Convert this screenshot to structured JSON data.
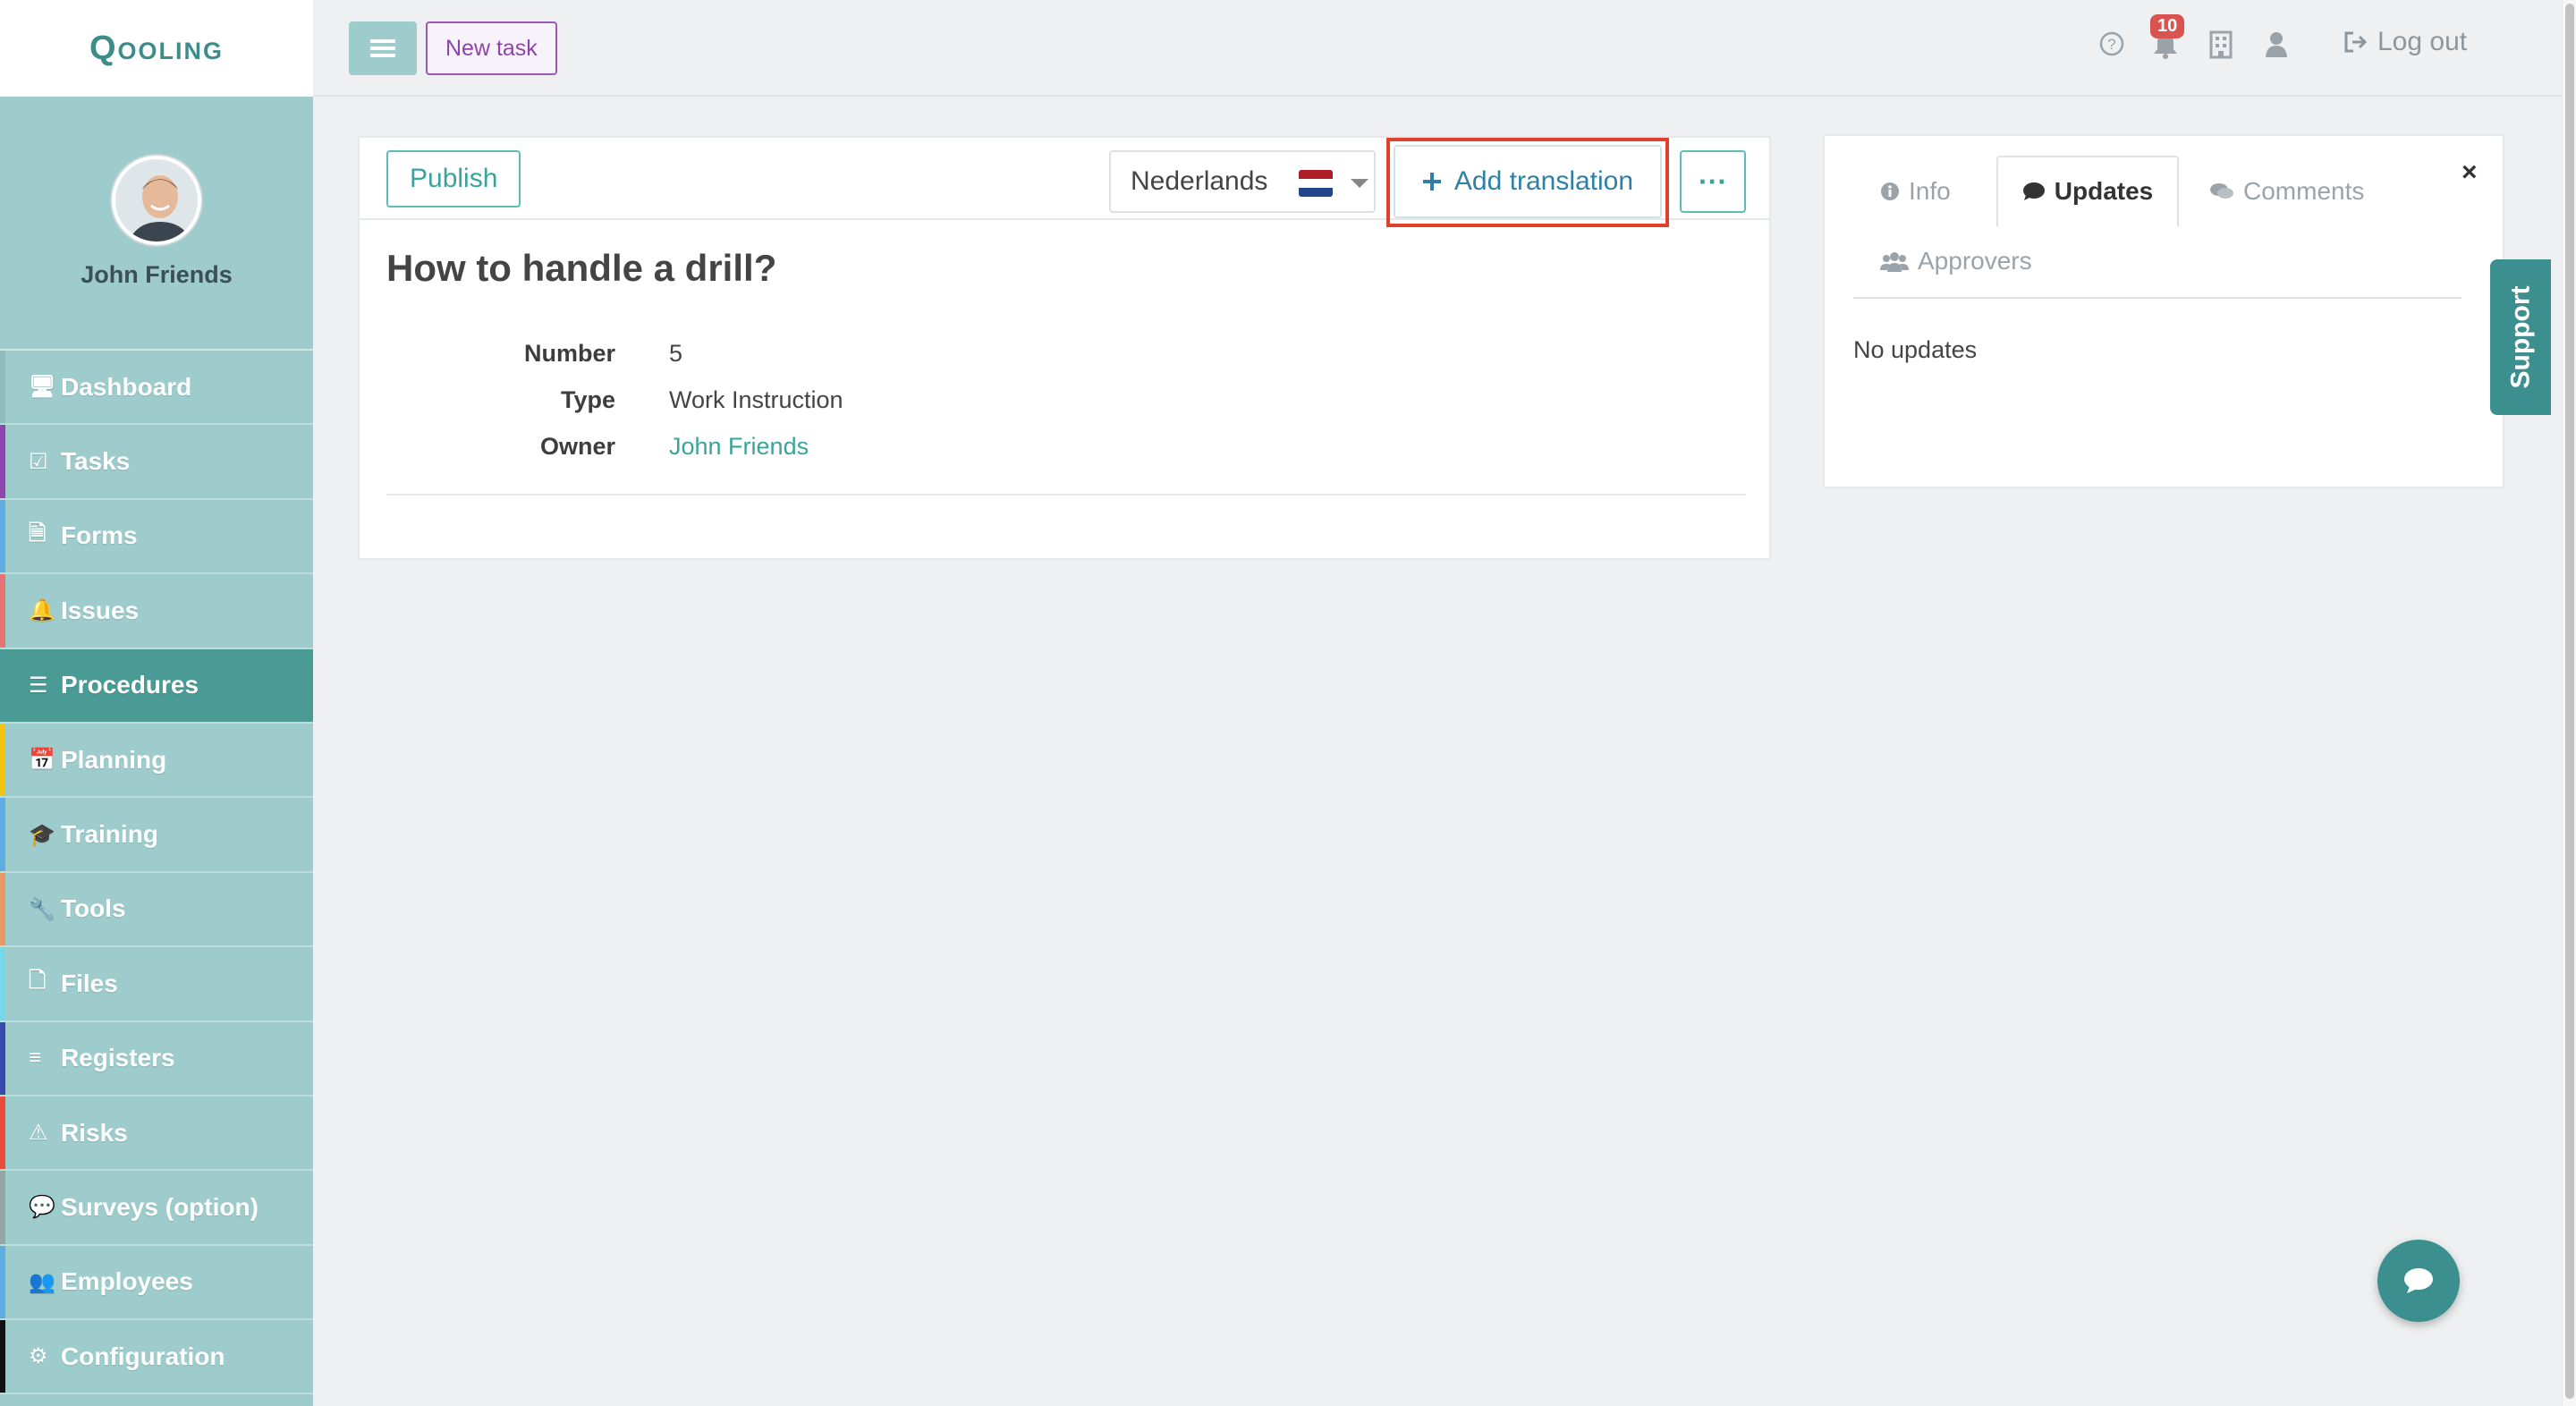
{
  "app": {
    "logo_text": "Qooling"
  },
  "user": {
    "name": "John Friends"
  },
  "topbar": {
    "new_task_label": "New task",
    "notification_count": "10",
    "logout_label": "Log out"
  },
  "sidebar": {
    "items": [
      {
        "label": "Dashboard",
        "icon": "monitor-icon",
        "color": "#8fbdbd"
      },
      {
        "label": "Tasks",
        "icon": "checkbox-icon",
        "color": "#8e44ad"
      },
      {
        "label": "Forms",
        "icon": "document-icon",
        "color": "#5dade2"
      },
      {
        "label": "Issues",
        "icon": "bell-icon",
        "color": "#e57373"
      },
      {
        "label": "Procedures",
        "icon": "procedures-icon",
        "color": "#4a9b95",
        "active": true
      },
      {
        "label": "Planning",
        "icon": "calendar-icon",
        "color": "#f1c40f"
      },
      {
        "label": "Training",
        "icon": "graduation-cap-icon",
        "color": "#5dade2"
      },
      {
        "label": "Tools",
        "icon": "wrench-icon",
        "color": "#e59866"
      },
      {
        "label": "Files",
        "icon": "file-icon",
        "color": "#76d7ea"
      },
      {
        "label": "Registers",
        "icon": "list-icon",
        "color": "#3949ab"
      },
      {
        "label": "Risks",
        "icon": "warning-icon",
        "color": "#e74c3c"
      },
      {
        "label": "Surveys (option)",
        "icon": "speech-bubble-icon",
        "color": "#95a5a6"
      },
      {
        "label": "Employees",
        "icon": "users-icon",
        "color": "#5dade2"
      },
      {
        "label": "Configuration",
        "icon": "gear-icon",
        "color": "#111111"
      }
    ]
  },
  "procedure": {
    "publish_label": "Publish",
    "language": "Nederlands",
    "add_translation_label": "Add translation",
    "more_label": "···",
    "title": "How to handle a drill?",
    "details": {
      "number_label": "Number",
      "number_value": "5",
      "type_label": "Type",
      "type_value": "Work Instruction",
      "owner_label": "Owner",
      "owner_value": "John Friends"
    }
  },
  "panel": {
    "tabs": {
      "info": "Info",
      "updates": "Updates",
      "comments": "Comments",
      "approvers": "Approvers"
    },
    "active_tab": "Updates",
    "empty_text": "No updates",
    "close_label": "×"
  },
  "support": {
    "label": "Support"
  },
  "colors": {
    "sidebar_bg": "#9ecccc",
    "active_nav": "#4a9b95",
    "accent": "#3aa39a",
    "highlight": "#e0402c"
  }
}
